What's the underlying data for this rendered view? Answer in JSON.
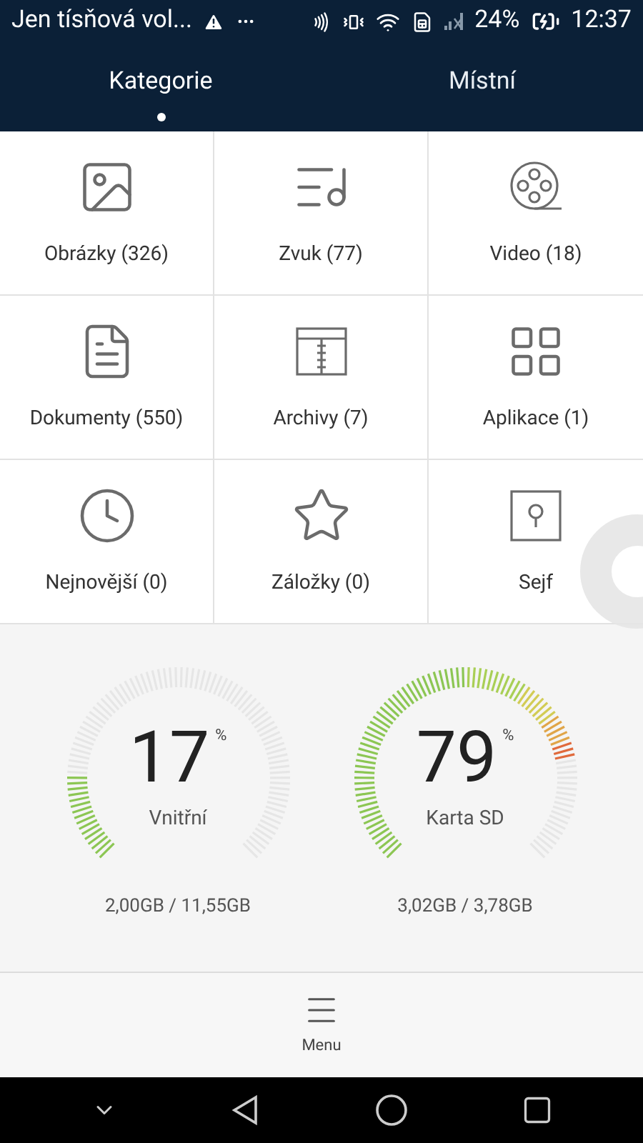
{
  "status_bar": {
    "notification": "Jen tísňová vol...",
    "battery": "24%",
    "time": "12:37"
  },
  "tabs": [
    {
      "label": "Kategorie",
      "selected": true
    },
    {
      "label": "Místní",
      "selected": false
    }
  ],
  "categories": [
    {
      "kind": "images",
      "label": "Obrázky (326)"
    },
    {
      "kind": "audio",
      "label": "Zvuk (77)"
    },
    {
      "kind": "video",
      "label": "Video (18)"
    },
    {
      "kind": "documents",
      "label": "Dokumenty (550)"
    },
    {
      "kind": "archives",
      "label": "Archivy (7)"
    },
    {
      "kind": "apps",
      "label": "Aplikace (1)"
    },
    {
      "kind": "recent",
      "label": "Nejnovější (0)"
    },
    {
      "kind": "bookmarks",
      "label": "Záložky (0)"
    },
    {
      "kind": "safe",
      "label": "Sejf"
    }
  ],
  "storage": [
    {
      "value": "17",
      "unit": "%",
      "name": "Vnitřní",
      "usage": "2,00GB / 11,55GB"
    },
    {
      "value": "79",
      "unit": "%",
      "name": "Karta SD",
      "usage": "3,02GB / 3,78GB"
    }
  ],
  "bottom_bar": {
    "menu_label": "Menu"
  }
}
